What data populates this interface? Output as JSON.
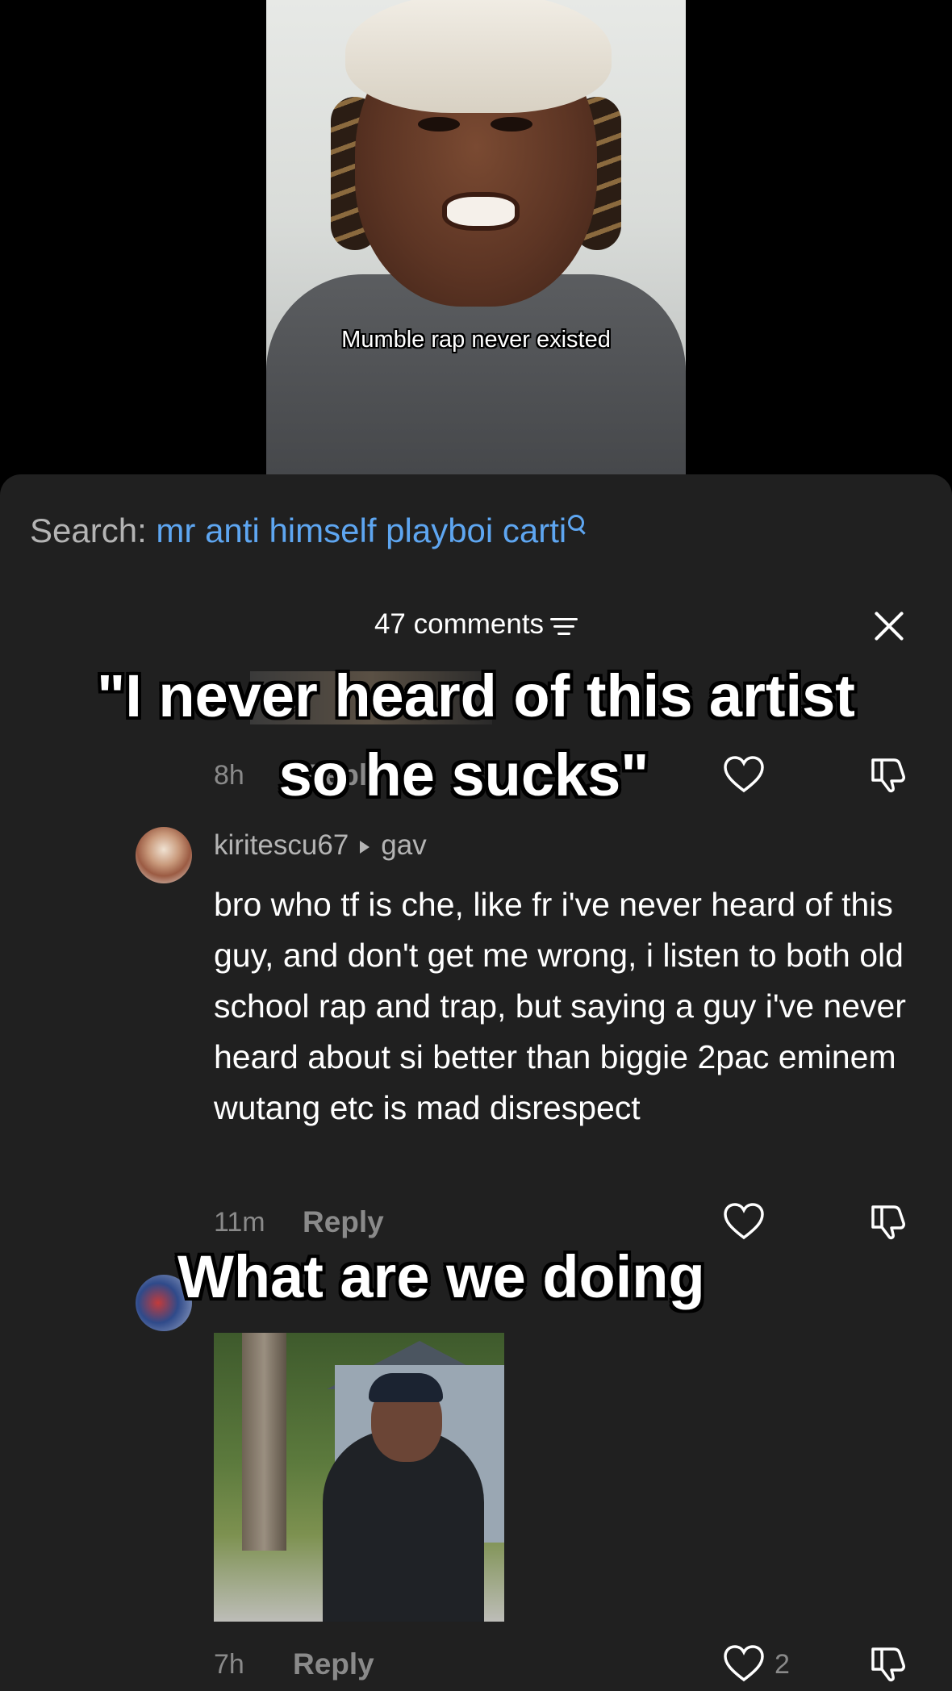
{
  "video": {
    "caption": "Mumble rap never existed"
  },
  "search": {
    "prefix": "Search: ",
    "query": "mr anti himself playboi carti"
  },
  "comments_header": {
    "count_label": "47 comments"
  },
  "overlays": {
    "top_line1": "\"I never heard of this artist",
    "top_line2": "so he sucks\"",
    "bottom": "What are we doing"
  },
  "comments": [
    {
      "time": "8h",
      "reply_label": "Reply"
    },
    {
      "username": "kiritescu67",
      "reply_to": "gav",
      "text": "bro who tf is che, like fr i've never heard of this guy, and don't get me wrong, i listen to both old school rap and trap, but saying a guy i've never heard about si better than biggie 2pac eminem wutang etc is mad disrespect",
      "time": "11m",
      "reply_label": "Reply"
    },
    {
      "time": "7h",
      "reply_label": "Reply",
      "likes": "2"
    }
  ],
  "colors": {
    "accent": "#5ea6f1",
    "sheet": "#202020",
    "muted": "#8a8a8a"
  },
  "icons": [
    "search-icon",
    "filter-icon",
    "close-icon",
    "heart-icon",
    "thumbs-down-icon",
    "chevron-right-icon"
  ]
}
